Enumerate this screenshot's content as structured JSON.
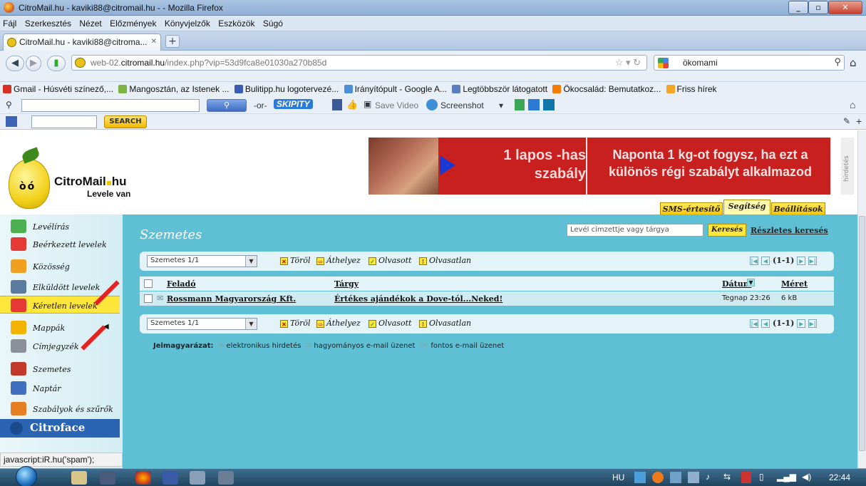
{
  "window": {
    "title": "CitroMail.hu - kaviki88@citromail.hu - - Mozilla Firefox"
  },
  "menu": [
    "Fájl",
    "Szerkesztés",
    "Nézet",
    "Előzmények",
    "Könyvjelzők",
    "Eszközök",
    "Súgó"
  ],
  "tab": {
    "label": "CitroMail.hu - kaviki88@citroma...",
    "new_tab": "+"
  },
  "address": {
    "prefix": "web-02.",
    "host": "citromail.hu",
    "path": "/index.php?vip=53d9fca8e01030a270b85d"
  },
  "search": {
    "value": "ökomami"
  },
  "bookmarks": [
    {
      "label": "Gmail - Húsvéti színező,...",
      "color": "#d93025"
    },
    {
      "label": "Mangosztán, az Istenek ...",
      "color": "#7cb342"
    },
    {
      "label": "Bulitipp.hu logotervezé...",
      "color": "#3b5bb5"
    },
    {
      "label": "Irányítópult - Google A...",
      "color": "#4a8fd8"
    },
    {
      "label": "Legtöbbször látogatott",
      "color": "#5a7fbf"
    },
    {
      "label": "Ökocsalád: Bemutatkoz...",
      "color": "#f57c00"
    },
    {
      "label": "Friss hírek",
      "color": "#f5a623"
    }
  ],
  "toolbar1": {
    "or": "-or-",
    "skipity": "SKIPITY",
    "save_video": "Save Video",
    "screenshot": "Screenshot"
  },
  "toolbar2": {
    "search_btn": "SEARCH"
  },
  "logo": {
    "name": "CitroMail",
    "tld": "hu",
    "tagline": "Levele van"
  },
  "ad": {
    "mid": "1 lapos -has szabály",
    "right": "Naponta 1 kg-ot fogysz, ha ezt a különös régi szabályt alkalmazod",
    "side": "hirdetés"
  },
  "top_tabs": [
    "SMS-értesítő",
    "Segítség",
    "Beállítások"
  ],
  "sidebar": [
    {
      "label": "Levélírás",
      "color": "#4caf50"
    },
    {
      "label": "Beérkezett levelek",
      "color": "#e53935"
    },
    {
      "label": "Közösség",
      "color": "#f0a020"
    },
    {
      "label": "Elküldött levelek",
      "color": "#5a7aa0"
    },
    {
      "label": "Kéretlen levelek",
      "color": "#e53935"
    },
    {
      "label": "Mappák",
      "color": "#f2b400"
    },
    {
      "label": "Címjegyzék",
      "color": "#8a8f99"
    },
    {
      "label": "Szemetes",
      "color": "#c0392b"
    },
    {
      "label": "Naptár",
      "color": "#3f6fbf"
    },
    {
      "label": "Szabályok és szűrők",
      "color": "#e67e22"
    },
    {
      "label": "Citroface",
      "color": "#ffffff"
    }
  ],
  "main": {
    "title": "Szemetes",
    "search_placeholder": "Levél címzettje vagy tárgya",
    "search_button": "Keresés",
    "advanced_search": "Részletes keresés",
    "folder": "Szemetes 1/1",
    "actions": [
      "Töröl",
      "Áthelyez",
      "Olvasott",
      "Olvasatlan"
    ],
    "pager": "(1-1)",
    "columns": [
      "Feladó",
      "Tárgy",
      "Dátum",
      "Méret"
    ],
    "rows": [
      {
        "from": "Rossmann Magyarország Kft.",
        "subject": "Értékes ajándékok a Dove-tól...Neked!",
        "date": "Tegnap 23:26",
        "size": "6 kB"
      }
    ],
    "legend": {
      "title": "Jelmagyarázat:",
      "items": [
        "elektronikus hirdetés",
        "hagyományos e-mail üzenet",
        "fontos e-mail üzenet"
      ]
    }
  },
  "status": "javascript:iR.hu('spam');",
  "taskbar": {
    "lang": "HU",
    "time": "22:44"
  }
}
